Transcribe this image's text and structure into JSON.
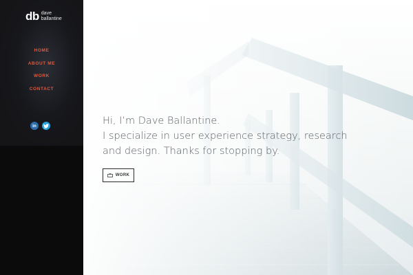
{
  "logo": {
    "mark": "db",
    "line1": "dave",
    "line2": "ballantine"
  },
  "nav": {
    "items": [
      "HOME",
      "ABOUT ME",
      "WORK",
      "CONTACT"
    ]
  },
  "social": {
    "linkedin_label": "in",
    "twitter_label": "t"
  },
  "hero": {
    "line1": "Hi, I’m Dave Ballantine.",
    "line2": "I specialize in user experience strategy, research",
    "line3": "and design. Thanks for stopping by.",
    "button_label": "WORK"
  },
  "colors": {
    "accent": "#e05a3d",
    "sidebar": "#0b0b0b",
    "text": "#5a5f64"
  }
}
